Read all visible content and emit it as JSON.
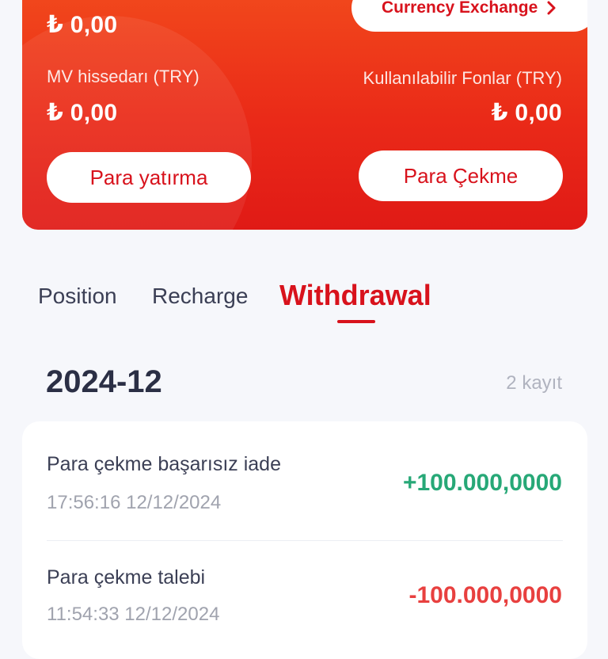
{
  "balance_card": {
    "top_amount": "₺ 0,00",
    "currency_exchange": {
      "label": "Currency Exchange"
    },
    "left_label": "MV hissedarı (TRY)",
    "left_amount": "₺ 0,00",
    "right_label": "Kullanılabilir Fonlar (TRY)",
    "right_amount": "₺ 0,00",
    "deposit_button": "Para yatırma",
    "withdraw_button": "Para Çekme"
  },
  "tabs": [
    {
      "label": "Position",
      "active": false
    },
    {
      "label": "Recharge",
      "active": false
    },
    {
      "label": "Withdrawal",
      "active": true
    }
  ],
  "records": {
    "month": "2024-12",
    "count": "2 kayıt",
    "items": [
      {
        "title": "Para çekme başarısız iade",
        "time": "17:56:16 12/12/2024",
        "amount": "+100.000,0000",
        "color": "#27a877"
      },
      {
        "title": "Para çekme talebi",
        "time": "11:54:33 12/12/2024",
        "amount": "-100.000,0000",
        "color": "#e8403f"
      }
    ]
  },
  "colors": {
    "accent": "#d8121c",
    "positive": "#27a877",
    "negative": "#e8403f"
  },
  "icons": {
    "currency_exchange": "chevron-right-icon"
  }
}
